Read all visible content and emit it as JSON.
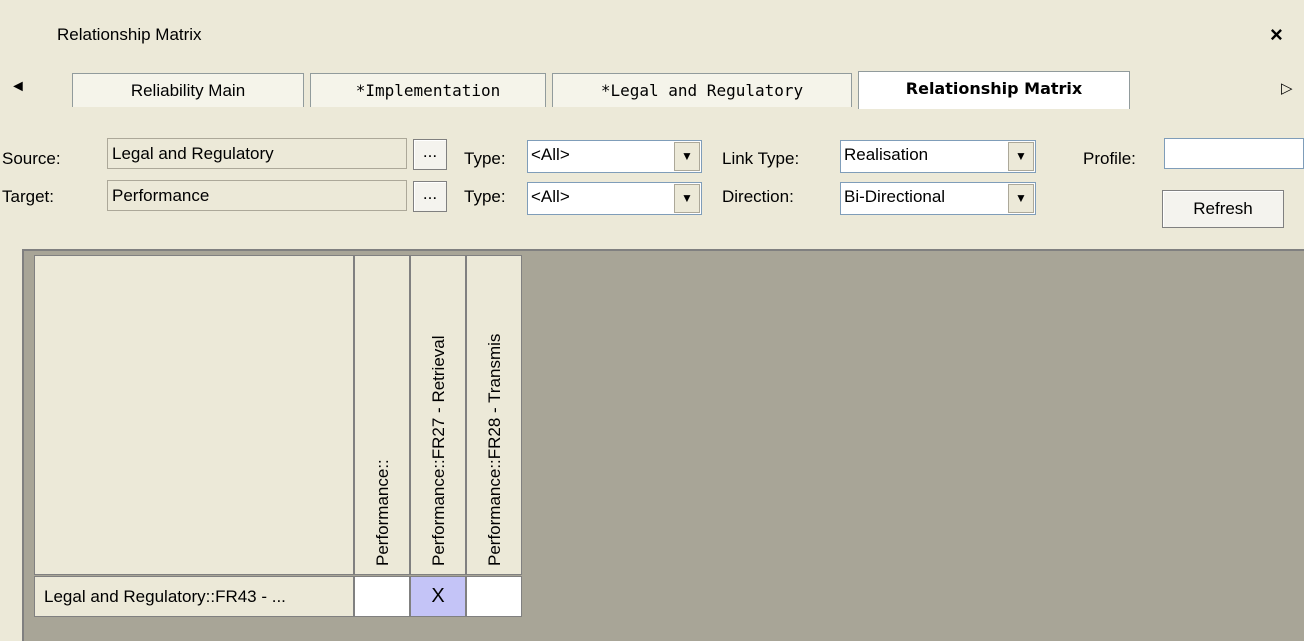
{
  "window": {
    "title": "Relationship Matrix",
    "close_glyph": "×"
  },
  "tabs": [
    {
      "label": "Reliability Main"
    },
    {
      "label": "*Implementation"
    },
    {
      "label": "*Legal and Regulatory"
    },
    {
      "label": "Relationship Matrix",
      "active": true
    }
  ],
  "tab_scroll": {
    "left_glyph": "◄",
    "right_glyph": "▷"
  },
  "toolbar": {
    "source_label": "Source:",
    "source_value": "Legal and Regulatory",
    "target_label": "Target:",
    "target_value": "Performance",
    "browse_label": "...",
    "type_label": "Type:",
    "source_type": "<All>",
    "target_type": "<All>",
    "link_type_label": "Link Type:",
    "link_type_value": "Realisation",
    "direction_label": "Direction:",
    "direction_value": "Bi-Directional",
    "profile_label": "Profile:",
    "profile_value": "",
    "refresh_label": "Refresh",
    "dropdown_glyph": "▼"
  },
  "matrix": {
    "columns": [
      "Performance::",
      "Performance::FR27 - Retrieval",
      "Performance::FR28 - Transmis"
    ],
    "rows": [
      {
        "label": "Legal and Regulatory::FR43 - ...",
        "cells": [
          "",
          "X",
          ""
        ]
      }
    ]
  },
  "colors": {
    "marked_cell": "#c4c4f7",
    "matrix_background": "#a8a597"
  }
}
